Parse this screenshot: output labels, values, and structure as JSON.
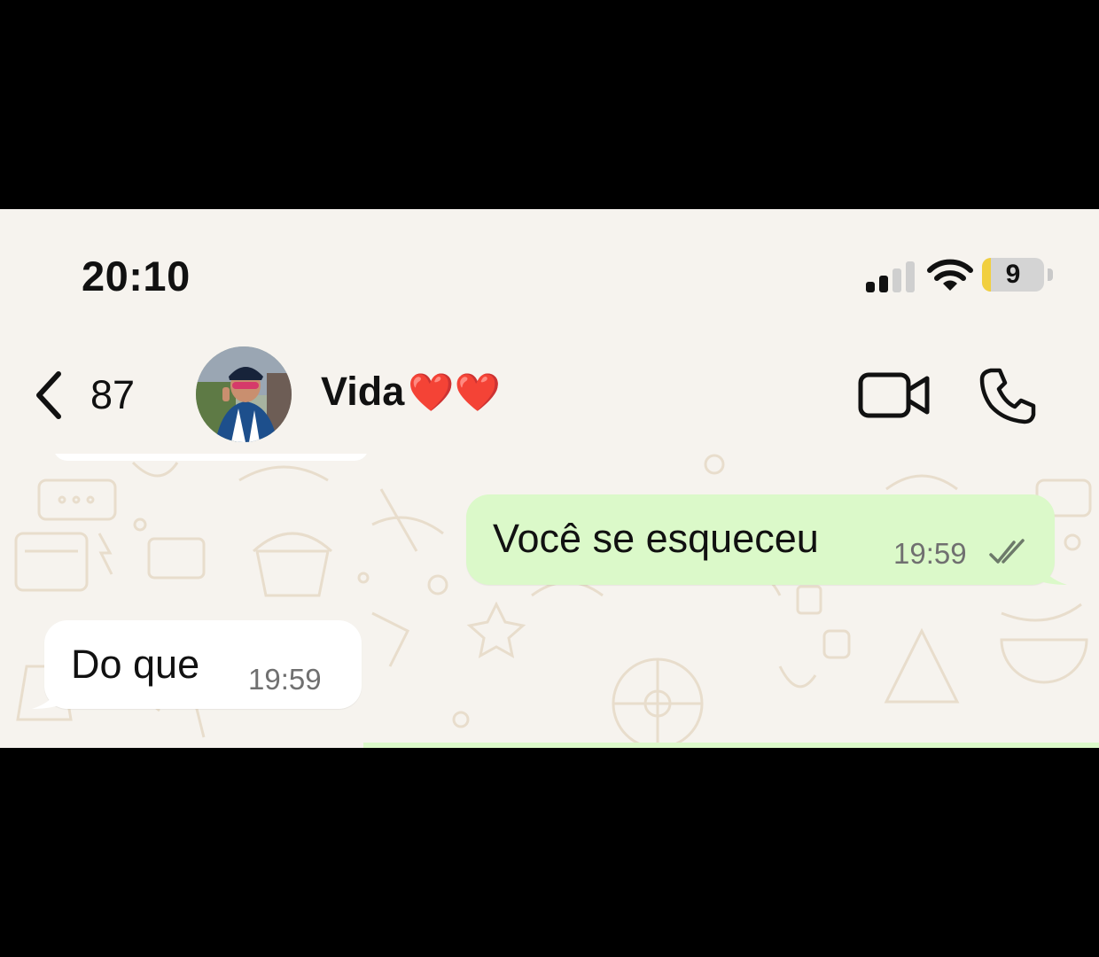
{
  "status_bar": {
    "time": "20:10",
    "battery_level": "9",
    "battery_fraction": 0.09,
    "signal_icon": "cellular-signal-icon",
    "wifi_icon": "wifi-icon"
  },
  "header": {
    "back_icon": "chevron-left-icon",
    "unread_count": "87",
    "contact_name": "Vida",
    "name_emoji": "❤️❤️",
    "video_icon": "video-camera-icon",
    "call_icon": "phone-icon"
  },
  "messages": [
    {
      "direction": "outgoing",
      "text": "Você se esqueceu",
      "time": "19:59",
      "status": "read"
    },
    {
      "direction": "incoming",
      "text": "Do que",
      "time": "19:59"
    }
  ],
  "colors": {
    "background": "#f6f3ee",
    "outgoing_bubble": "#dbf9c9",
    "incoming_bubble": "#ffffff",
    "battery_fill": "#f1cf3f",
    "heart": "#e0182d"
  }
}
